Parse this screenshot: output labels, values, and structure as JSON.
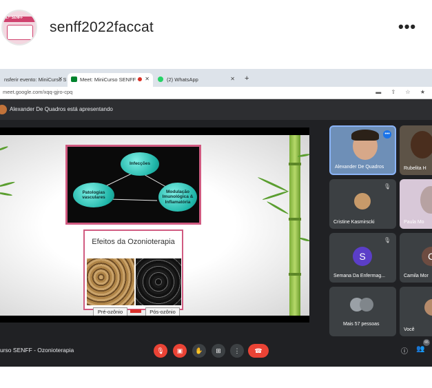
{
  "post": {
    "username": "senff2022faccat",
    "more": "•••",
    "avatar_text": "17º SENFF"
  },
  "browser": {
    "tabs": [
      {
        "label": "nsferir evento: MiniCurso S"
      },
      {
        "label": "Meet: MiniCurso SENFF -"
      },
      {
        "label": "(2) WhatsApp"
      }
    ],
    "new_tab": "+",
    "url": "meet.google.com/xqq-gjro-cpq",
    "addr_icons": "▬ ⇧ ☆ ★"
  },
  "meet": {
    "presenting_text": "Alexander De Quadros está apresentando",
    "meeting_title": "urso SENFF - Ozonioterapia",
    "people_badge": "65",
    "participants": [
      {
        "name": "Alexander De Quadros"
      },
      {
        "name": "Rubelita H"
      },
      {
        "name": "Cristine Kasmirscki"
      },
      {
        "name": "Paula Mo"
      },
      {
        "name": "Semana Da Enfermag..."
      },
      {
        "name": "Camila Mor"
      },
      {
        "name": "Mais 57 pessoas"
      },
      {
        "name": "Você"
      }
    ],
    "avatar_letters": {
      "semana": "S",
      "camila": "C"
    }
  },
  "slide": {
    "diagram": {
      "top": "Infecções",
      "left": "Patologias vasculares",
      "right": "Modulação Imunológica & Inflamatória"
    },
    "effects_title": "Efeitos da Ozonioterapia",
    "before": "Pré-ozônio",
    "after": "Pós-ozônio"
  },
  "colors": {
    "meet_bg": "#202124",
    "tile_bg": "#3c4043",
    "red": "#ea4335",
    "pink_frame": "#d05a80",
    "teal": "#1fb5a8"
  }
}
